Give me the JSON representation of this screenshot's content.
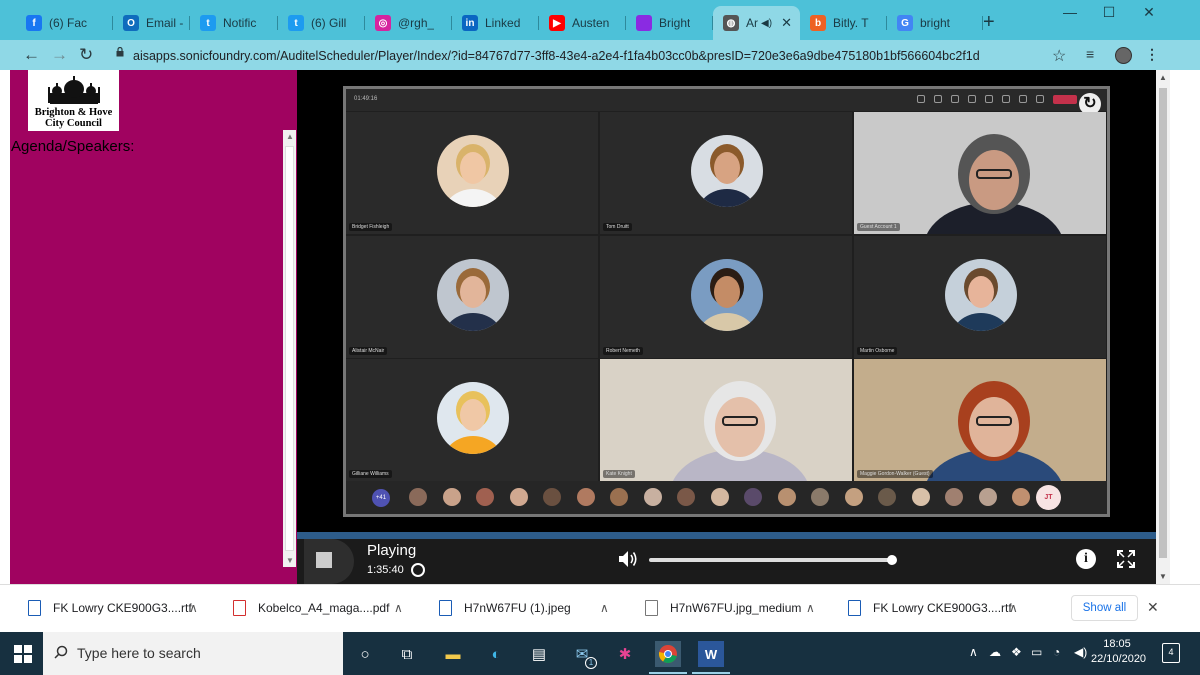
{
  "browser": {
    "tabs": [
      {
        "label": "(6) Fac",
        "icon": "facebook-icon",
        "color": "#1877f2",
        "glyph": "f"
      },
      {
        "label": "Email -",
        "icon": "outlook-icon",
        "color": "#0f6cbd",
        "glyph": "O"
      },
      {
        "label": "Notific",
        "icon": "twitter-icon",
        "color": "#1d9bf0",
        "glyph": "t"
      },
      {
        "label": "(6) Gill",
        "icon": "twitter-icon",
        "color": "#1d9bf0",
        "glyph": "t"
      },
      {
        "label": "@rgh_",
        "icon": "instagram-icon",
        "color": "#d6249f",
        "glyph": "◎"
      },
      {
        "label": "Linked",
        "icon": "linkedin-icon",
        "color": "#0a66c2",
        "glyph": "in"
      },
      {
        "label": "Austen",
        "icon": "youtube-icon",
        "color": "#ff0000",
        "glyph": "▶"
      },
      {
        "label": "Bright",
        "icon": "brighton-icon",
        "color": "#8a2be2",
        "glyph": ""
      },
      {
        "label": "Ar",
        "icon": "globe-icon",
        "color": "#555555",
        "glyph": "◍",
        "active": true
      },
      {
        "label": "Bitly. T",
        "icon": "bitly-icon",
        "color": "#ee6123",
        "glyph": "b"
      },
      {
        "label": "bright",
        "icon": "google-icon",
        "color": "#4285f4",
        "glyph": "G"
      }
    ],
    "url": "aisapps.sonicfoundry.com/AuditelScheduler/Player/Index/?id=84767d77-3ff8-43e4-a2e4-f1fa4b03cc0b&presID=720e3e6a9dbe475180b1bf566604bc2f1d"
  },
  "page": {
    "logo_line1": "Brighton & Hove",
    "logo_line2": "City Council",
    "agenda_label": "Agenda/Speakers:"
  },
  "meeting": {
    "elapsed": "01:49:16",
    "participants": [
      {
        "name": "Bridget Fishleigh",
        "bg": "#e8d2b8",
        "skin": "#f0c7a4",
        "hair": "#d9b36a",
        "cloth": "#f4f4f4",
        "kind": "avatar"
      },
      {
        "name": "Tom Druitt",
        "bg": "#d8dde3",
        "skin": "#d7a382",
        "hair": "#8b5a2b",
        "cloth": "#1e2a44",
        "kind": "avatar"
      },
      {
        "name": "Guest Account 1",
        "bg": "#c9c9c9",
        "skin": "#c99a82",
        "hair": "#555555",
        "cloth": "#1c1f2a",
        "kind": "video"
      },
      {
        "name": "Alistair McNair",
        "bg": "#bfc6cf",
        "skin": "#e2b59a",
        "hair": "#9a6a3a",
        "cloth": "#23304a",
        "kind": "avatar"
      },
      {
        "name": "Robert Nemeth",
        "bg": "#7a9cc2",
        "skin": "#c48c66",
        "hair": "#2b1d14",
        "cloth": "#d8c8a8",
        "kind": "avatar"
      },
      {
        "name": "Martin Osborne",
        "bg": "#c5d0da",
        "skin": "#e7b49a",
        "hair": "#6a4a2e",
        "cloth": "#1e3a5a",
        "kind": "avatar"
      },
      {
        "name": "Gilliane Williams",
        "bg": "#dfe7ee",
        "skin": "#f0c8a6",
        "hair": "#e8c15c",
        "cloth": "#f5a623",
        "kind": "avatar"
      },
      {
        "name": "Kate Knight",
        "bg": "#d9d2c6",
        "skin": "#e4c0aa",
        "hair": "#e6e6e6",
        "cloth": "#b9b6c6",
        "kind": "video"
      },
      {
        "name": "Maggie Gordon-Walker (Guest)",
        "bg": "#c3ad8c",
        "skin": "#e0b49a",
        "hair": "#a8401e",
        "cloth": "#2a4a7a",
        "kind": "video"
      }
    ],
    "more_count": "+41",
    "self_initials": "JT"
  },
  "player": {
    "status": "Playing",
    "time": "1:35:40",
    "progress": 1.0
  },
  "downloads": [
    {
      "name": "FK Lowry CKE900G3....rtf",
      "type": "word"
    },
    {
      "name": "Kobelco_A4_maga....pdf",
      "type": "pdf"
    },
    {
      "name": "H7nW67FU (1).jpeg",
      "type": "image"
    },
    {
      "name": "H7nW67FU.jpg_medium",
      "type": "file"
    },
    {
      "name": "FK Lowry CKE900G3....rtf",
      "type": "word"
    }
  ],
  "downloads_show_all": "Show all",
  "taskbar": {
    "search_placeholder": "Type here to search",
    "time": "18:05",
    "date": "22/10/2020",
    "notifications": "4",
    "mail_badge": "1"
  }
}
